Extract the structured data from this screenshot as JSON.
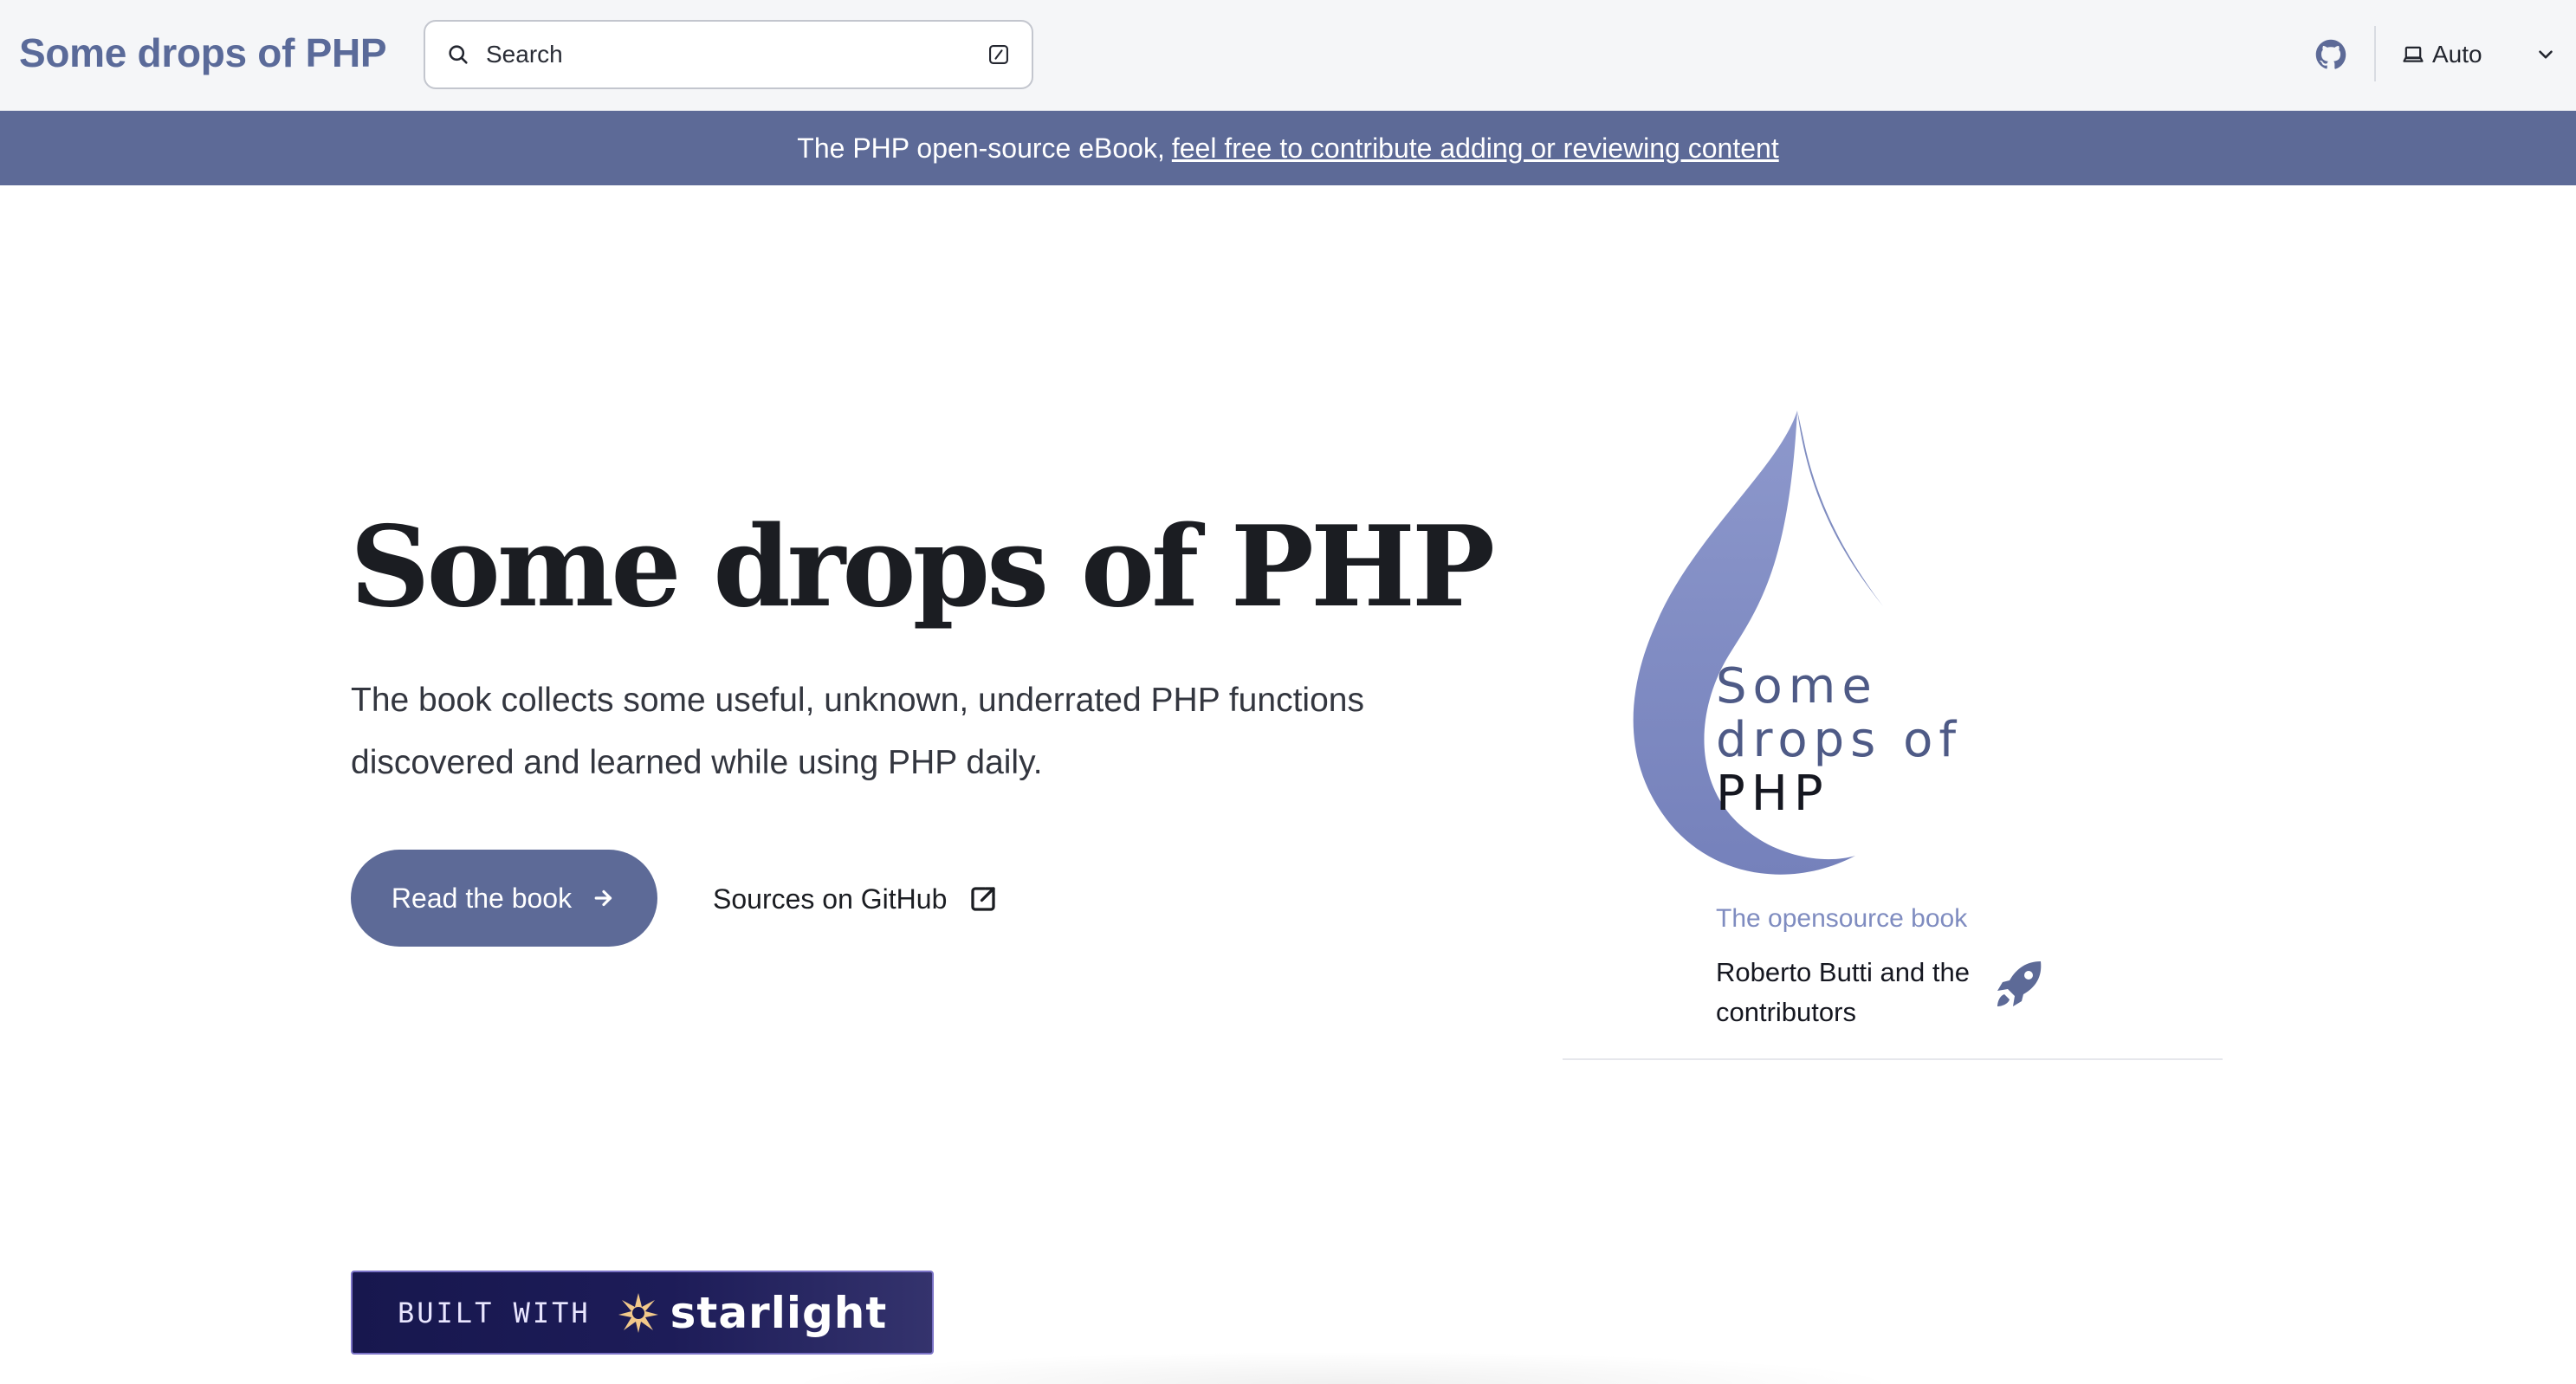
{
  "header": {
    "site_title": "Some drops of PHP",
    "search_placeholder": "Search",
    "theme_value": "Auto"
  },
  "banner": {
    "text": "The PHP open-source eBook,",
    "link_text": "feel free to contribute adding or reviewing content"
  },
  "hero": {
    "title": "Some drops of PHP",
    "tagline": "The book collects some useful, unknown, underrated PHP functions discovered and learned while using PHP daily.",
    "primary_action": "Read the book",
    "secondary_action": "Sources on GitHub"
  },
  "cover": {
    "title_line1": "Some",
    "title_line2": "drops of",
    "title_line3": "PHP",
    "subtitle": "The opensource book",
    "authors": "Roberto Butti and the contributors"
  },
  "footer_badge": {
    "prefix": "BUILT WITH",
    "brand": "starlight"
  },
  "colors": {
    "accent": "#5d6a97",
    "drop": "#7f8cc0",
    "badge_bg": "#17174e",
    "badge_star": "#f2c98a"
  },
  "icons": {
    "search": "search-icon",
    "shortcut": "keyboard-shortcut-icon",
    "github": "github-icon",
    "theme": "laptop-icon",
    "dropdown": "chevron-down-icon",
    "arrow": "arrow-right-icon",
    "external": "external-link-icon",
    "rocket": "rocket-icon",
    "star": "starlight-star-icon"
  }
}
